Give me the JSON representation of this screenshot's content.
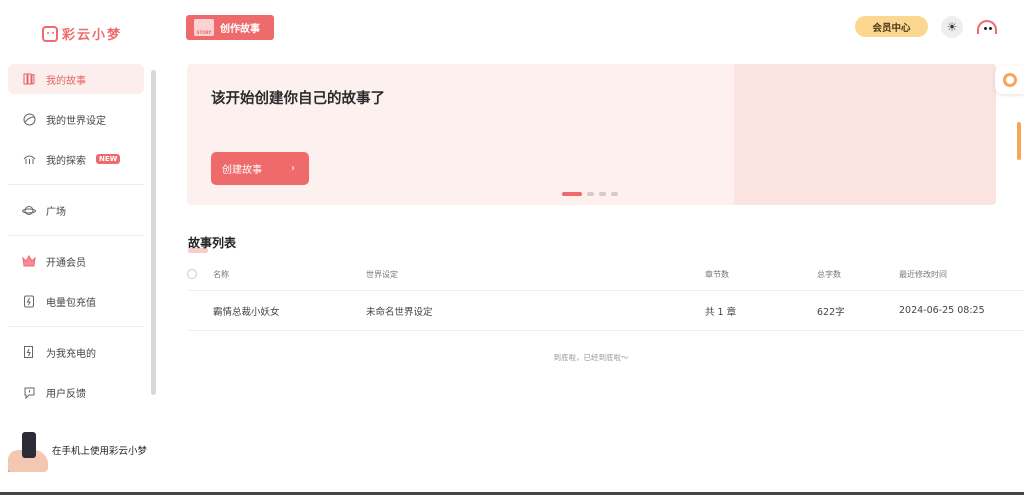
{
  "app": {
    "name": "彩云小梦"
  },
  "sidebar": {
    "items": [
      {
        "label": "我的故事",
        "icon": "book-shelf-icon",
        "active": true
      },
      {
        "label": "我的世界设定",
        "icon": "globe-icon"
      },
      {
        "label": "我的探索",
        "icon": "explore-icon",
        "badge": "NEW"
      },
      {
        "label": "广场",
        "icon": "planet-icon"
      },
      {
        "label": "开通会员",
        "icon": "crown-icon"
      },
      {
        "label": "电量包充值",
        "icon": "battery-icon"
      },
      {
        "label": "为我充电的",
        "icon": "charge-icon"
      },
      {
        "label": "用户反馈",
        "icon": "feedback-icon"
      }
    ],
    "promo": "在手机上使用彩云小梦"
  },
  "header": {
    "create_label": "创作故事",
    "story_tag": "STORY",
    "member_label": "会员中心"
  },
  "banner": {
    "title": "该开始创建你自己的故事了",
    "cta_label": "创建故事",
    "cta_arrow": "›",
    "slides": 4,
    "active_slide": 0
  },
  "story_list": {
    "title": "故事列表",
    "columns": [
      "名称",
      "世界设定",
      "章节数",
      "总字数",
      "最近修改时间"
    ],
    "rows": [
      {
        "name": "霸情总裁小妖女",
        "world": "未命名世界设定",
        "chapters": "共 1 章",
        "words": "622字",
        "modified": "2024-06-25 08:25"
      }
    ],
    "end_text": "到底啦，已经到底啦～"
  },
  "colors": {
    "accent": "#ef6b6b",
    "member": "#fbd78f",
    "banner": "#fde7e6"
  }
}
